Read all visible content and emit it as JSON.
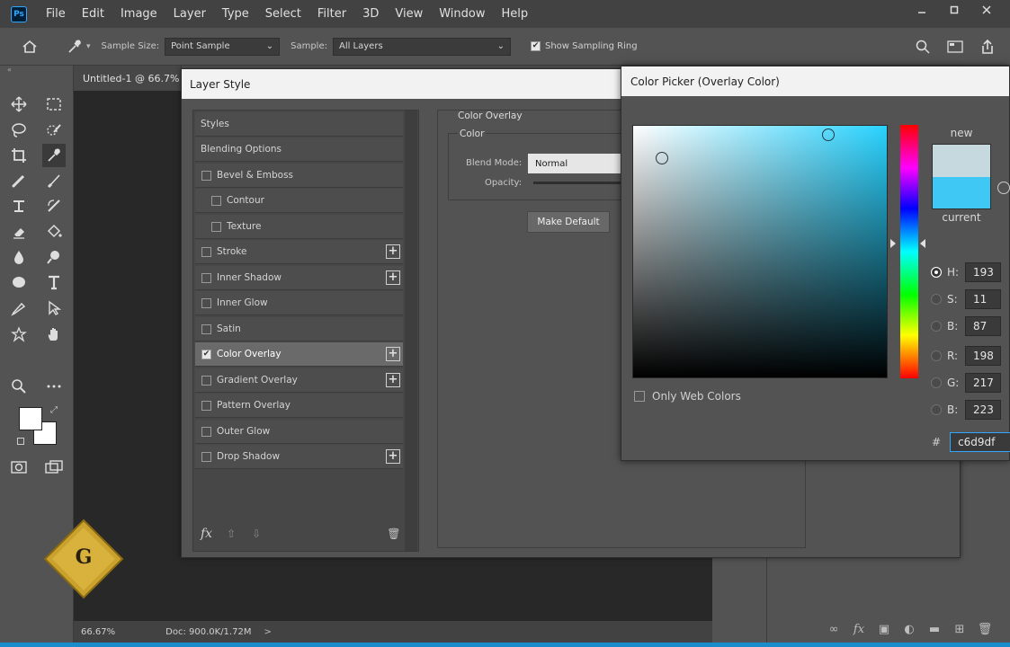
{
  "app": {
    "logo": "Ps"
  },
  "menu": [
    "File",
    "Edit",
    "Image",
    "Layer",
    "Type",
    "Select",
    "Filter",
    "3D",
    "View",
    "Window",
    "Help"
  ],
  "options_bar": {
    "sample_size_label": "Sample Size:",
    "sample_size_value": "Point Sample",
    "sample_label": "Sample:",
    "sample_value": "All Layers",
    "show_ring_label": "Show Sampling Ring",
    "show_ring_checked": true
  },
  "document": {
    "tab_title": "Untitled-1 @ 66.7%",
    "zoom": "66.67%",
    "doc_info": "Doc: 900.0K/1.72M"
  },
  "layer_style": {
    "title": "Layer Style",
    "items": [
      {
        "label": "Styles",
        "type": "header"
      },
      {
        "label": "Blending Options",
        "type": "header"
      },
      {
        "label": "Bevel & Emboss",
        "checked": false,
        "plus": false
      },
      {
        "label": "Contour",
        "checked": false,
        "sub": true
      },
      {
        "label": "Texture",
        "checked": false,
        "sub": true
      },
      {
        "label": "Stroke",
        "checked": false,
        "plus": true
      },
      {
        "label": "Inner Shadow",
        "checked": false,
        "plus": true
      },
      {
        "label": "Inner Glow",
        "checked": false,
        "plus": false
      },
      {
        "label": "Satin",
        "checked": false,
        "plus": false
      },
      {
        "label": "Color Overlay",
        "checked": true,
        "plus": true,
        "selected": true
      },
      {
        "label": "Gradient Overlay",
        "checked": false,
        "plus": true
      },
      {
        "label": "Pattern Overlay",
        "checked": false,
        "plus": false
      },
      {
        "label": "Outer Glow",
        "checked": false,
        "plus": false
      },
      {
        "label": "Drop Shadow",
        "checked": false,
        "plus": true
      }
    ],
    "footer": {
      "fx": "fx"
    },
    "content": {
      "section_title": "Color Overlay",
      "group_title": "Color",
      "blend_mode_label": "Blend Mode:",
      "blend_mode_value": "Normal",
      "opacity_label": "Opacity:",
      "make_default_label": "Make Default"
    }
  },
  "color_picker": {
    "title": "Color Picker (Overlay Color)",
    "new_label": "new",
    "current_label": "current",
    "new_color": "#c6d9df",
    "current_color": "#40c8f4",
    "fields": [
      {
        "label": "H:",
        "value": "193",
        "selected": true
      },
      {
        "label": "S:",
        "value": "11",
        "selected": false
      },
      {
        "label": "B:",
        "value": "87",
        "selected": false
      },
      {
        "label": "R:",
        "value": "198",
        "selected": false
      },
      {
        "label": "G:",
        "value": "217",
        "selected": false
      },
      {
        "label": "B:",
        "value": "223",
        "selected": false
      }
    ],
    "hex_label": "#",
    "hex_value": "c6d9df",
    "only_web_colors_label": "Only Web Colors",
    "only_web_colors_checked": false
  },
  "colors": {
    "accent": "#31a8ff",
    "panel": "#535353",
    "titlebar": "#f2f2f2"
  }
}
